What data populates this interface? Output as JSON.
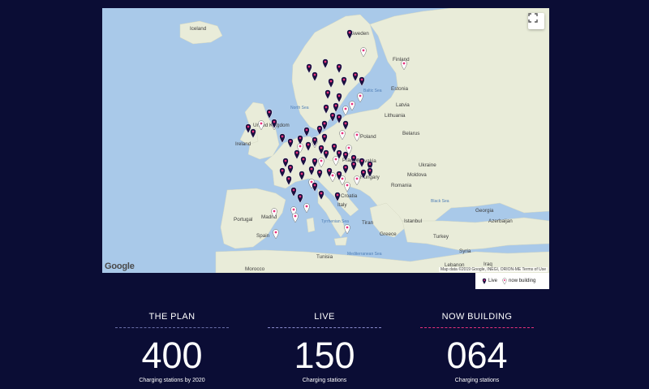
{
  "map": {
    "fullscreen_icon": "fullscreen-icon",
    "google_logo": "Google",
    "attribution": "Map data ©2019 Google, INEGI, ORION-ME   Terms of Use",
    "country_labels": [
      "Iceland",
      "Sweden",
      "Finland",
      "Estonia",
      "Latvia",
      "Lithuania",
      "Belarus",
      "Poland",
      "Ukraine",
      "Moldova",
      "Romania",
      "Slovakia",
      "Hungary",
      "Croatia",
      "Italy",
      "Greece",
      "Turkey",
      "Georgia",
      "Azerbaijan",
      "Portugal",
      "Spain",
      "Madrid",
      "Morocco",
      "Tunisia",
      "Syria",
      "Lebanon",
      "Iraq",
      "Ireland",
      "United Kingdom",
      "Prague",
      "Istanbul",
      "Tiran"
    ],
    "sea_labels": [
      "North Sea",
      "Baltic Sea",
      "Black Sea",
      "Mediterranean Sea",
      "Tyrrhenian Sea"
    ],
    "colors": {
      "live": "#1a1040",
      "building": "#ffffff",
      "accent": "#e8317c",
      "water": "#a9c9e9",
      "land": "#e9ecd9"
    }
  },
  "legend": {
    "live_label": "Live",
    "building_label": "now building",
    "live_icon": "live-marker-icon",
    "building_icon": "building-marker-icon"
  },
  "stats": [
    {
      "title": "THE PLAN",
      "value": "400",
      "caption": "Charging stations by 2020",
      "rule_color": "#6a6ea8"
    },
    {
      "title": "LIVE",
      "value": "150",
      "caption": "Charging stations",
      "rule_color": "#8a8acb"
    },
    {
      "title": "NOW BUILDING",
      "value": "064",
      "caption": "Charging stations",
      "rule_color": "#e8317c"
    }
  ]
}
